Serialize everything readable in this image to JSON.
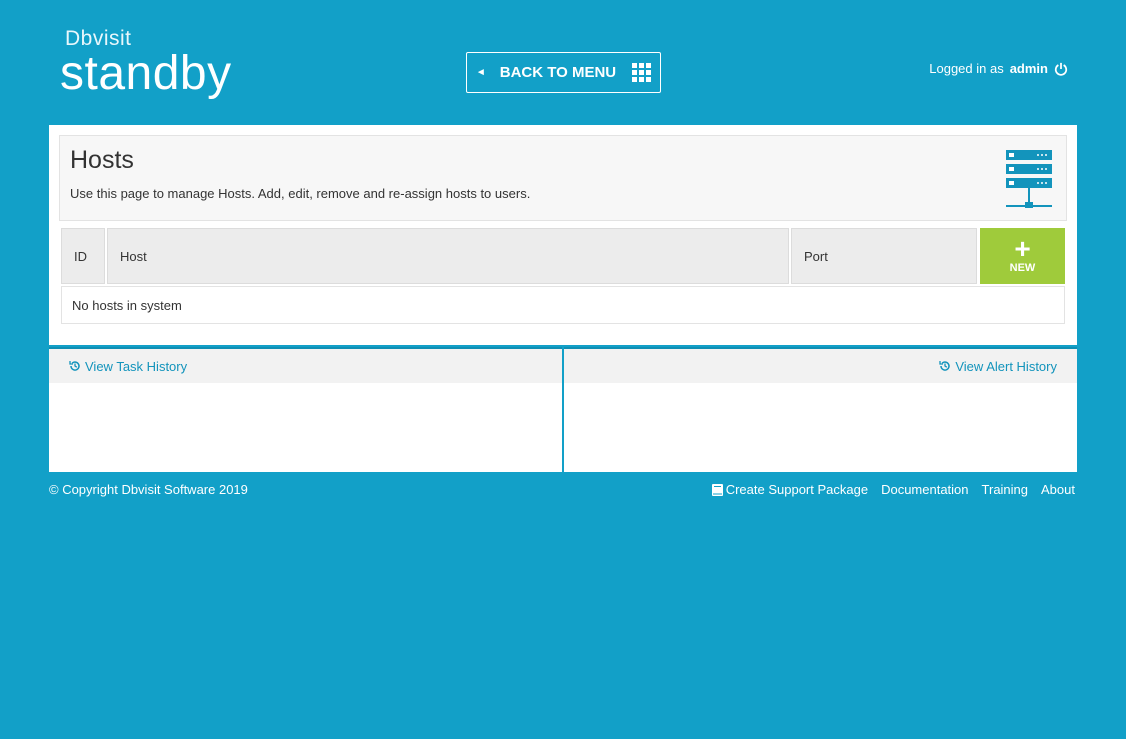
{
  "header": {
    "brand": "Dbvisit",
    "product": "standby",
    "back_label": "BACK TO MENU",
    "logged_in_prefix": "Logged in as",
    "username": "admin"
  },
  "page": {
    "title": "Hosts",
    "description": "Use this page to manage Hosts. Add, edit, remove and re-assign hosts to users."
  },
  "table": {
    "columns": [
      "ID",
      "Host",
      "Port"
    ],
    "new_label": "NEW",
    "empty_message": "No hosts in system"
  },
  "history": {
    "task_label": "View Task History",
    "alert_label": "View Alert History"
  },
  "footer": {
    "copyright": "© Copyright Dbvisit Software 2019",
    "links": [
      "Create Support Package",
      "Documentation",
      "Training",
      "About"
    ]
  },
  "colors": {
    "background": "#12a0c8",
    "accent_green": "#9fcb3b",
    "link_blue": "#1394bc"
  }
}
